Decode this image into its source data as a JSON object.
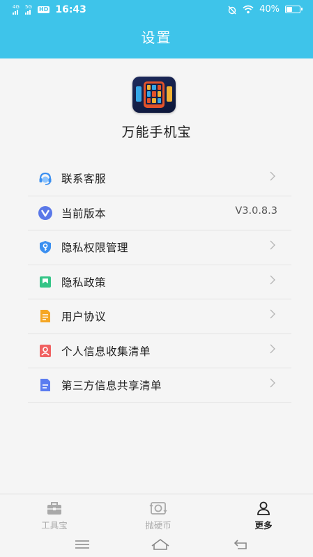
{
  "status_bar": {
    "network_1": "4G",
    "network_2": "5G",
    "hd": "HD",
    "time": "16:43",
    "battery": "40%"
  },
  "header": {
    "title": "设置"
  },
  "app": {
    "name": "万能手机宝",
    "logo_icon": "phone-app-logo-icon"
  },
  "menu": {
    "items": [
      {
        "label": "联系客服",
        "icon": "headset-icon",
        "color": "#3b8ff0"
      },
      {
        "label": "当前版本",
        "icon": "version-v-icon",
        "color": "#5a78e8",
        "value": "V3.0.8.3"
      },
      {
        "label": "隐私权限管理",
        "icon": "shield-key-icon",
        "color": "#3b8ff0"
      },
      {
        "label": "隐私政策",
        "icon": "policy-book-icon",
        "color": "#34c486"
      },
      {
        "label": "用户协议",
        "icon": "document-icon",
        "color": "#f5a623"
      },
      {
        "label": "个人信息收集清单",
        "icon": "person-card-icon",
        "color": "#f06161"
      },
      {
        "label": "第三方信息共享清单",
        "icon": "list-doc-icon",
        "color": "#5b7cf0"
      }
    ]
  },
  "tabs": [
    {
      "label": "工具宝",
      "icon": "toolbox-icon",
      "active": false
    },
    {
      "label": "抛硬币",
      "icon": "coin-flip-icon",
      "active": false
    },
    {
      "label": "更多",
      "icon": "person-icon",
      "active": true
    }
  ],
  "colors": {
    "accent": "#3ec4ea",
    "background": "#f5f5f5"
  }
}
